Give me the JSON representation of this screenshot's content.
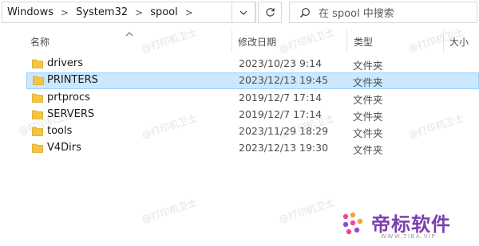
{
  "address": {
    "crumbs": [
      "Windows",
      "System32",
      "spool"
    ],
    "dropdown_icon": "chevron-down-icon",
    "refresh_icon": "refresh-icon"
  },
  "search": {
    "placeholder": "在 spool 中搜索"
  },
  "columns": {
    "name": "名称",
    "date": "修改日期",
    "type": "类型",
    "size": "大小"
  },
  "files": [
    {
      "name": "drivers",
      "date": "2023/10/23 9:14",
      "type": "文件夹",
      "selected": false
    },
    {
      "name": "PRINTERS",
      "date": "2023/12/13 19:45",
      "type": "文件夹",
      "selected": true
    },
    {
      "name": "prtprocs",
      "date": "2019/12/7 17:14",
      "type": "文件夹",
      "selected": false
    },
    {
      "name": "SERVERS",
      "date": "2019/12/7 17:14",
      "type": "文件夹",
      "selected": false
    },
    {
      "name": "tools",
      "date": "2023/11/29 18:29",
      "type": "文件夹",
      "selected": false
    },
    {
      "name": "V4Dirs",
      "date": "2023/12/13 19:30",
      "type": "文件夹",
      "selected": false
    }
  ],
  "watermark": {
    "text": "@打印机卫士"
  },
  "logo": {
    "name": "帝标软件",
    "sub": "WWW.TIBA.VIP"
  },
  "colors": {
    "selection_bg": "#cce8ff",
    "selection_border": "#99d1ff",
    "folder": "#f5c542",
    "logo": "#7a3fb0"
  }
}
